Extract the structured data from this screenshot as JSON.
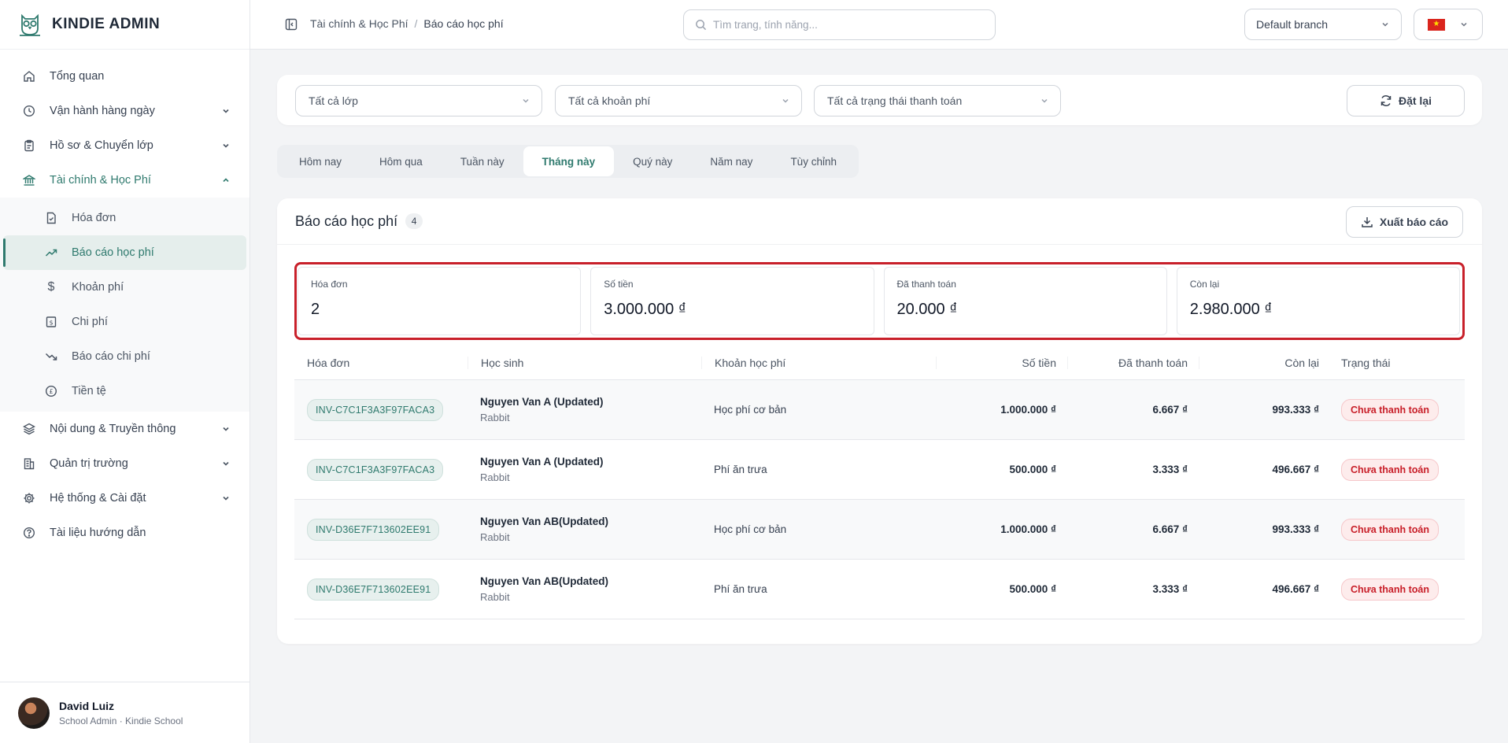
{
  "brand": {
    "title": "KINDIE ADMIN"
  },
  "sidebar": {
    "items": [
      {
        "label": "Tổng quan",
        "icon": "home-icon"
      },
      {
        "label": "Vận hành hàng ngày",
        "icon": "clock-icon"
      },
      {
        "label": "Hồ sơ & Chuyển lớp",
        "icon": "clipboard-icon"
      },
      {
        "label": "Tài chính & Học Phí",
        "icon": "bank-icon"
      },
      {
        "label": "Nội dung & Truyền thông",
        "icon": "layers-icon"
      },
      {
        "label": "Quản trị trường",
        "icon": "building-icon"
      },
      {
        "label": "Hệ thống & Cài đặt",
        "icon": "gear-icon"
      },
      {
        "label": "Tài liệu hướng dẫn",
        "icon": "help-icon"
      }
    ],
    "finance_sub": [
      {
        "label": "Hóa đơn",
        "icon": "invoice-icon"
      },
      {
        "label": "Báo cáo học phí",
        "icon": "trending-up-icon"
      },
      {
        "label": "Khoản phí",
        "icon": "dollar-icon"
      },
      {
        "label": "Chi phí",
        "icon": "receipt-icon"
      },
      {
        "label": "Báo cáo chi phí",
        "icon": "trending-down-icon"
      },
      {
        "label": "Tiền tệ",
        "icon": "currency-icon"
      }
    ]
  },
  "user": {
    "name": "David Luiz",
    "role": "School Admin · Kindie School"
  },
  "header": {
    "breadcrumb_parent": "Tài chính & Học Phí",
    "breadcrumb_sep": "/",
    "breadcrumb_current": "Báo cáo học phí",
    "search_placeholder": "Tìm trang, tính năng...",
    "branch": "Default branch"
  },
  "filters": {
    "class": "Tất cả lớp",
    "fee": "Tất cả khoản phí",
    "payment_status": "Tất cả trạng thái thanh toán",
    "reset_label": "Đặt lại"
  },
  "periods": [
    "Hôm nay",
    "Hôm qua",
    "Tuần này",
    "Tháng này",
    "Quý này",
    "Năm nay",
    "Tùy chỉnh"
  ],
  "report": {
    "title": "Báo cáo học phí",
    "count": "4",
    "export_label": "Xuất báo cáo",
    "stats": [
      {
        "label": "Hóa đơn",
        "value": "2"
      },
      {
        "label": "Số tiền",
        "value": "3.000.000 ₫"
      },
      {
        "label": "Đã thanh toán",
        "value": "20.000 ₫"
      },
      {
        "label": "Còn lại",
        "value": "2.980.000 ₫"
      }
    ],
    "columns": [
      "Hóa đơn",
      "Học sinh",
      "Khoản học phí",
      "Số tiền",
      "Đã thanh toán",
      "Còn lại",
      "Trạng thái"
    ],
    "rows": [
      {
        "invoice": "INV-C7C1F3A3F97FACA3",
        "student": "Nguyen Van A (Updated)",
        "class": "Rabbit",
        "fee": "Học phí cơ bản",
        "amount": "1.000.000 ₫",
        "paid": "6.667 ₫",
        "remaining": "993.333 ₫",
        "status": "Chưa thanh toán"
      },
      {
        "invoice": "INV-C7C1F3A3F97FACA3",
        "student": "Nguyen Van A (Updated)",
        "class": "Rabbit",
        "fee": "Phí ăn trưa",
        "amount": "500.000 ₫",
        "paid": "3.333 ₫",
        "remaining": "496.667 ₫",
        "status": "Chưa thanh toán"
      },
      {
        "invoice": "INV-D36E7F713602EE91",
        "student": "Nguyen Van AB(Updated)",
        "class": "Rabbit",
        "fee": "Học phí cơ bản",
        "amount": "1.000.000 ₫",
        "paid": "6.667 ₫",
        "remaining": "993.333 ₫",
        "status": "Chưa thanh toán"
      },
      {
        "invoice": "INV-D36E7F713602EE91",
        "student": "Nguyen Van AB(Updated)",
        "class": "Rabbit",
        "fee": "Phí ăn trưa",
        "amount": "500.000 ₫",
        "paid": "3.333 ₫",
        "remaining": "496.667 ₫",
        "status": "Chưa thanh toán"
      }
    ]
  },
  "colors": {
    "accent": "#2f7a6e",
    "highlight_border": "#c8202a",
    "status_red": "#c81e28"
  }
}
